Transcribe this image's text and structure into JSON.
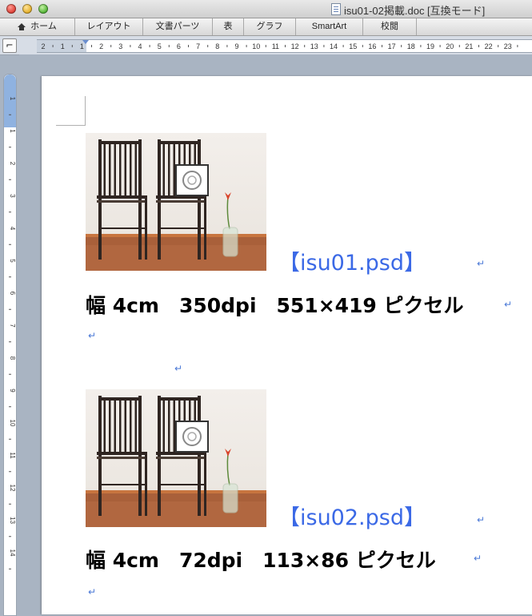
{
  "window": {
    "title": "isu01-02掲載.doc [互換モード]"
  },
  "ribbon": {
    "tabs": [
      {
        "label": "ホーム"
      },
      {
        "label": "レイアウト"
      },
      {
        "label": "文書パーツ"
      },
      {
        "label": "表"
      },
      {
        "label": "グラフ"
      },
      {
        "label": "SmartArt"
      },
      {
        "label": "校閲"
      }
    ]
  },
  "ruler": {
    "ticks": [
      "2",
      "1",
      "1",
      "2",
      "3",
      "4",
      "5",
      "6",
      "7",
      "8",
      "9",
      "10",
      "11",
      "12",
      "13",
      "14",
      "15",
      "16",
      "17",
      "18",
      "19",
      "20",
      "21",
      "22",
      "23"
    ],
    "vticks": [
      "1",
      "1",
      "2",
      "3",
      "4",
      "5",
      "6",
      "7",
      "8",
      "9",
      "10",
      "11",
      "12",
      "13",
      "14"
    ]
  },
  "document": {
    "blocks": [
      {
        "image": "chairs-photo",
        "caption": "【isu01.psd】",
        "info": "幅 4cm　350dpi　551×419 ピクセル"
      },
      {
        "image": "chairs-photo",
        "caption": "【isu02.psd】",
        "info": "幅 4cm　72dpi　113×86 ピクセル"
      }
    ],
    "return_mark": "↵"
  }
}
